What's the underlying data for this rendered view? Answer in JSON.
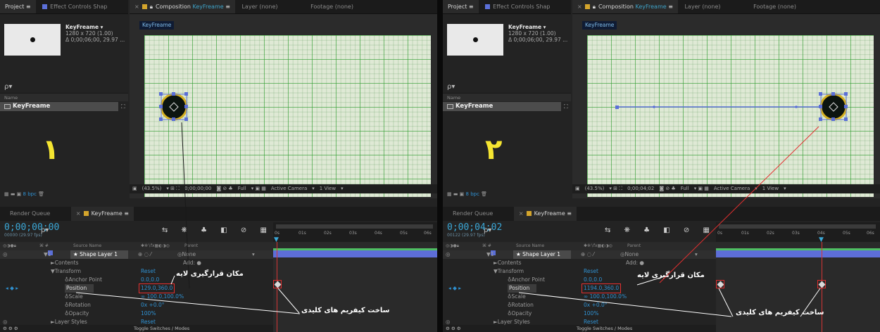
{
  "panes": [
    {
      "id": "a",
      "tabs": {
        "project": "Project",
        "effect_controls": "Effect Controls Shap",
        "composition": "Composition",
        "comp_name": "KeyFreame",
        "layer": "Layer (none)",
        "footage": "Footage (none)"
      },
      "project": {
        "item_name": "KeyFreame ▾",
        "dims": "1280 x 720 (1.00)",
        "duration": "Δ 0;00;06;00, 29.97 ...",
        "search_glyph": "ρ▾",
        "col_name": "Name",
        "item_row": "KeyFreame",
        "bpc": "8 bpc"
      },
      "marker_number": "۱",
      "viewer": {
        "comp_title": "KeyFreame",
        "zoom": "(43.5%)",
        "time": "0;00;00;00",
        "res": "Full",
        "camera": "Active Camera",
        "view": "1 View"
      },
      "timeline": {
        "tab_render": "Render Queue",
        "tab_comp": "KeyFreame",
        "timecode": "0;00;00;00",
        "fps": "00000 (29.97 fps)",
        "col_source": "Source Name",
        "col_parent": "Parent",
        "layer_name": "★ Shape Layer 1",
        "layer_num": "1",
        "parent_value": "None",
        "contents": "Contents",
        "add": "Add: ●",
        "transform": "Transform",
        "reset": "Reset",
        "anchor_label": "Anchor Point",
        "anchor_value": "0.0,0.0",
        "position_label": "Position",
        "position_value": "129.0,360.0",
        "scale_label": "Scale",
        "scale_value": "∞ 100.0,100.0%",
        "rotation_label": "Rotation",
        "rotation_value": "0x +0.0°",
        "opacity_label": "Opacity",
        "opacity_value": "100%",
        "layer_styles": "Layer Styles",
        "toggle": "Toggle Switches / Modes",
        "ruler_ticks": [
          "0s",
          "01s",
          "02s",
          "03s",
          "04s",
          "05s",
          "06s"
        ]
      },
      "ann_position": "مکان قرارگیری لایه",
      "ann_keyframe": "ساخت کیفریم های کلیدی"
    },
    {
      "id": "b",
      "tabs": {
        "project": "Project",
        "effect_controls": "Effect Controls Shap",
        "composition": "Composition",
        "comp_name": "KeyFreame",
        "layer": "Layer (none)",
        "footage": "Footage (none)"
      },
      "project": {
        "item_name": "KeyFreame ▾",
        "dims": "1280 x 720 (1.00)",
        "duration": "Δ 0;00;06;00, 29.97 ...",
        "search_glyph": "ρ▾",
        "col_name": "Name",
        "item_row": "KeyFreame",
        "bpc": "8 bpc"
      },
      "marker_number": "۲",
      "viewer": {
        "comp_title": "KeyFreame",
        "zoom": "(43.5%)",
        "time": "0;00;04;02",
        "res": "Full",
        "camera": "Active Camera",
        "view": "1 View"
      },
      "timeline": {
        "tab_render": "Render Queue",
        "tab_comp": "KeyFreame",
        "timecode": "0;00;04;02",
        "fps": "00122 (29.97 fps)",
        "col_source": "Source Name",
        "col_parent": "Parent",
        "layer_name": "★ Shape Layer 1",
        "layer_num": "1",
        "parent_value": "None",
        "contents": "Contents",
        "add": "Add: ●",
        "transform": "Transform",
        "reset": "Reset",
        "anchor_label": "Anchor Point",
        "anchor_value": "0.0,0.0",
        "position_label": "Position",
        "position_value": "1194.0,360.0",
        "scale_label": "Scale",
        "scale_value": "∞ 100.0,100.0%",
        "rotation_label": "Rotation",
        "rotation_value": "0x +0.0°",
        "opacity_label": "Opacity",
        "opacity_value": "100%",
        "layer_styles": "Layer Styles",
        "toggle": "Toggle Switches / Modes",
        "ruler_ticks": [
          "0s",
          "01s",
          "02s",
          "03s",
          "04s",
          "05s",
          "06s"
        ]
      },
      "ann_position": "مکان قرارگیری لایه",
      "ann_keyframe": "ساخت کیفریم های کلیدی"
    }
  ],
  "colors": {
    "timecode": "#3ba7d6",
    "highlight": "#e43030",
    "marker": "#f5e531",
    "layer_bar": "#5d6ed8"
  }
}
